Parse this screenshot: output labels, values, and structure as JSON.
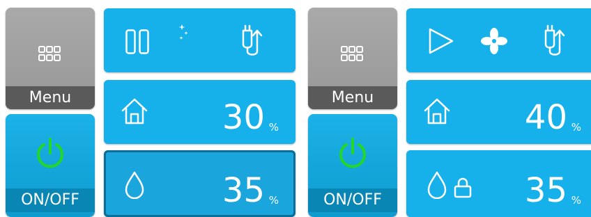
{
  "colors": {
    "tile_blue": "#16b0ea",
    "menu_gray": "#a0a0a0",
    "menu_label_bg": "#5a5a5a",
    "power_green": "#25d62a",
    "text_white": "#ffffff"
  },
  "panels": [
    {
      "menu": {
        "label": "Menu",
        "icon": "grid-icon"
      },
      "power": {
        "label": "ON/OFF",
        "icon": "power-icon",
        "on": true
      },
      "mode_icons": [
        "pause-icon",
        "night-mode-icon",
        "pipe-flow-icon"
      ],
      "indoor": {
        "icon": "home-icon",
        "value": "30",
        "unit": "%"
      },
      "humidity": {
        "icon": "water-drop-icon",
        "value": "35",
        "unit": "%",
        "locked": false
      }
    },
    {
      "menu": {
        "label": "Menu",
        "icon": "grid-icon"
      },
      "power": {
        "label": "ON/OFF",
        "icon": "power-icon",
        "on": true
      },
      "mode_icons": [
        "play-icon",
        "fan-icon",
        "pipe-flow-icon"
      ],
      "indoor": {
        "icon": "home-icon",
        "value": "40",
        "unit": "%"
      },
      "humidity": {
        "icon": "water-drop-icon",
        "value": "35",
        "unit": "%",
        "locked": true
      }
    }
  ]
}
